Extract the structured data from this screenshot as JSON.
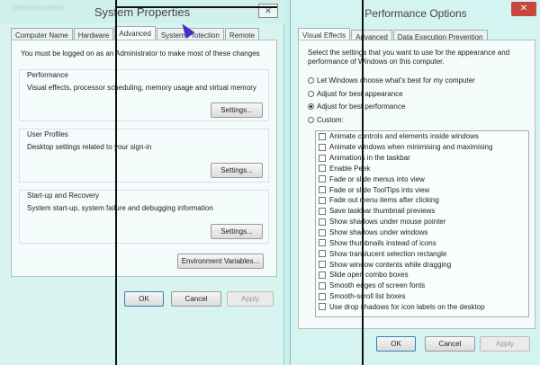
{
  "system_properties": {
    "title": "System Properties",
    "blurred_caption": "Windows edition",
    "close_glyph": "✕",
    "tabs": [
      "Computer Name",
      "Hardware",
      "Advanced",
      "System Protection",
      "Remote"
    ],
    "active_tab": "Advanced",
    "admin_notice": "You must be logged on as an Administrator to make most of these changes",
    "performance": {
      "label": "Performance",
      "description": "Visual effects, processor scheduling, memory usage and virtual memory",
      "settings_button": "Settings..."
    },
    "user_profiles": {
      "label": "User Profiles",
      "description": "Desktop settings related to your sign-in",
      "settings_button": "Settings..."
    },
    "startup_recovery": {
      "label": "Start-up and Recovery",
      "description": "System start-up, system failure and debugging information",
      "settings_button": "Settings..."
    },
    "env_vars_button": "Environment Variables...",
    "ok": "OK",
    "cancel": "Cancel",
    "apply": "Apply"
  },
  "performance_options": {
    "title": "Performance Options",
    "close_glyph": "✕",
    "tabs": [
      "Visual Effects",
      "Advanced",
      "Data Execution Prevention"
    ],
    "active_tab": "Visual Effects",
    "intro_line1": "Select the settings that you want to use for the appearance and",
    "intro_line2": "performance of Windows on this computer.",
    "radios": [
      {
        "label": "Let Windows choose what's best for my computer",
        "selected": false
      },
      {
        "label": "Adjust for best appearance",
        "selected": false
      },
      {
        "label": "Adjust for best performance",
        "selected": true
      },
      {
        "label": "Custom:",
        "selected": false
      }
    ],
    "effects": [
      "Animate controls and elements inside windows",
      "Animate windows when minimising and maximising",
      "Animations in the taskbar",
      "Enable Peek",
      "Fade or slide menus into view",
      "Fade or slide ToolTips into view",
      "Fade out menu items after clicking",
      "Save taskbar thumbnail previews",
      "Show shadows under mouse pointer",
      "Show shadows under windows",
      "Show thumbnails instead of icons",
      "Show translucent selection rectangle",
      "Show window contents while dragging",
      "Slide open combo boxes",
      "Smooth edges of screen fonts",
      "Smooth-scroll list boxes",
      "Use drop shadows for icon labels on the desktop"
    ],
    "ok": "OK",
    "cancel": "Cancel",
    "apply": "Apply"
  }
}
